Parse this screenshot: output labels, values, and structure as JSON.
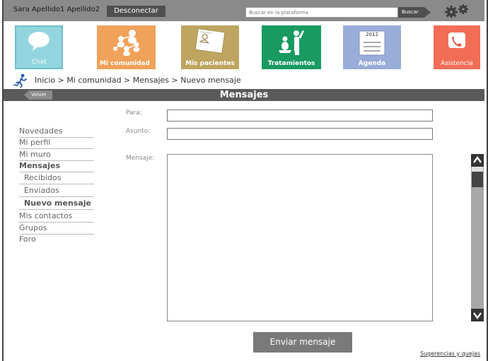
{
  "topbar": {
    "user_name": "Sara Apellido1 Apellido2",
    "disconnect_label": "Desconectar",
    "search_placeholder": "Buscar en la plataforma",
    "search_button": "Buscar",
    "settings_icon": "gears-icon"
  },
  "apps": {
    "chat": {
      "label": "Chat",
      "color": "#92d5df",
      "icon": "speech-bubble-icon"
    },
    "comunidad": {
      "label": "Mi comunidad",
      "color": "#f0a15a",
      "icon": "people-network-icon"
    },
    "pacientes": {
      "label": "Mis pacientes",
      "color": "#bea560",
      "icon": "patient-card-icon"
    },
    "tratamientos": {
      "label": "Tratamientos",
      "color": "#189a61",
      "icon": "exercise-icon"
    },
    "agenda": {
      "label": "Agenda",
      "color": "#9aacd8",
      "icon": "calendar-icon",
      "year": "2012"
    },
    "asistencia": {
      "label": "Asistencia",
      "color": "#f26d56",
      "icon": "phone-icon"
    }
  },
  "breadcrumb": {
    "icon": "running-person-icon",
    "text": "Inicio > Mi comunidad > Mensajes > Nuevo mensaje"
  },
  "section": {
    "back_label": "Volver",
    "title": "Mensajes"
  },
  "nav": {
    "items": [
      {
        "label": "Novedades"
      },
      {
        "label": "Mi perfil"
      },
      {
        "label": "Mi muro"
      },
      {
        "label": "Mensajes"
      },
      {
        "label": "Recibidos"
      },
      {
        "label": "Enviados"
      },
      {
        "label": "Nuevo mensaje"
      },
      {
        "label": "Mis contactos"
      },
      {
        "label": "Grupos"
      },
      {
        "label": "Foro"
      }
    ]
  },
  "form": {
    "to_label": "Para:",
    "to_value": "",
    "subject_label": "Asunto:",
    "subject_value": "",
    "message_label": "Mensaje:",
    "message_value": "",
    "send_label": "Enviar mensaje"
  },
  "footer": {
    "feedback_link": "Sugerencias y quejas"
  }
}
